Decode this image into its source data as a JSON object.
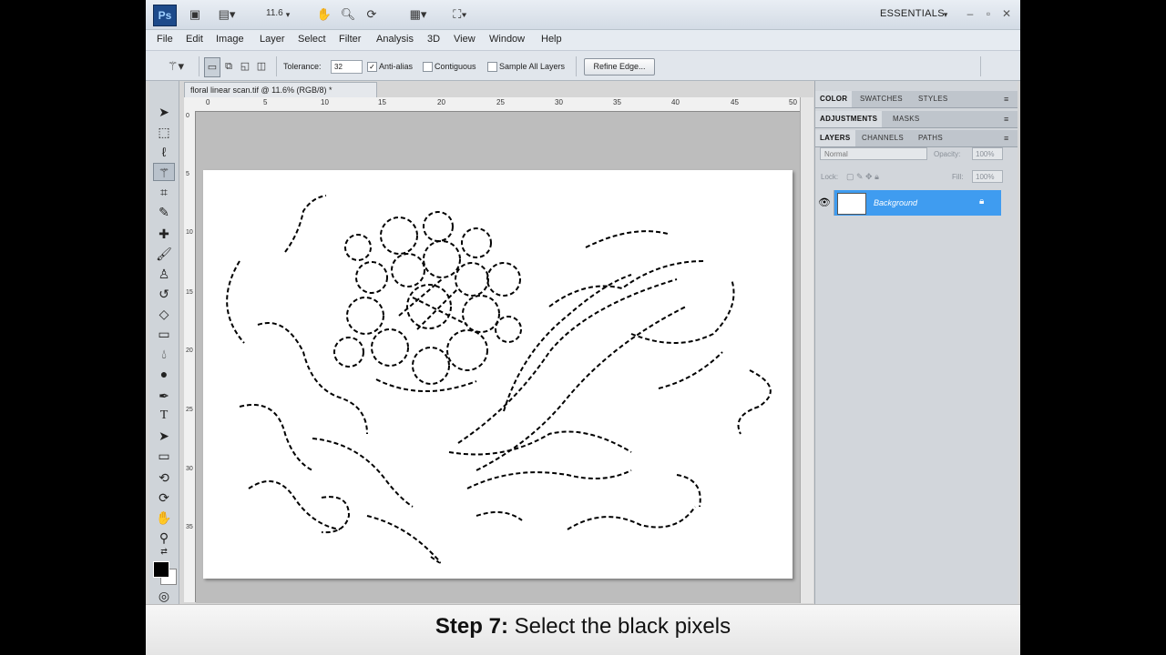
{
  "app": {
    "logo": "Ps",
    "zoom": "11.6",
    "workspace": "ESSENTIALS"
  },
  "menu": [
    "File",
    "Edit",
    "Image",
    "Layer",
    "Select",
    "Filter",
    "Analysis",
    "3D",
    "View",
    "Window",
    "Help"
  ],
  "options": {
    "tolerance_label": "Tolerance:",
    "tolerance_value": "32",
    "antialias_label": "Anti-alias",
    "antialias_checked": true,
    "contiguous_label": "Contiguous",
    "contiguous_checked": false,
    "sample_all_label": "Sample All Layers",
    "sample_all_checked": false,
    "refine_edge_label": "Refine Edge..."
  },
  "document": {
    "tab_title": "floral linear scan.tif @ 11.6% (RGB/8) *",
    "ruler_top": [
      "0",
      "5",
      "10",
      "15",
      "20",
      "25",
      "30",
      "35",
      "40",
      "45",
      "50"
    ],
    "ruler_left": [
      "0",
      "5",
      "10",
      "15",
      "20",
      "25",
      "30",
      "35"
    ]
  },
  "panels": {
    "group1": [
      "COLOR",
      "SWATCHES",
      "STYLES"
    ],
    "group2": [
      "ADJUSTMENTS",
      "MASKS"
    ],
    "group3": [
      "LAYERS",
      "CHANNELS",
      "PATHS"
    ],
    "blend_mode": "Normal",
    "opacity_label": "Opacity:",
    "opacity_value": "100%",
    "lock_label": "Lock:",
    "fill_label": "Fill:",
    "fill_value": "100%",
    "layer_name": "Background"
  },
  "caption": {
    "step": "Step 7:",
    "text": "Select the black pixels"
  }
}
